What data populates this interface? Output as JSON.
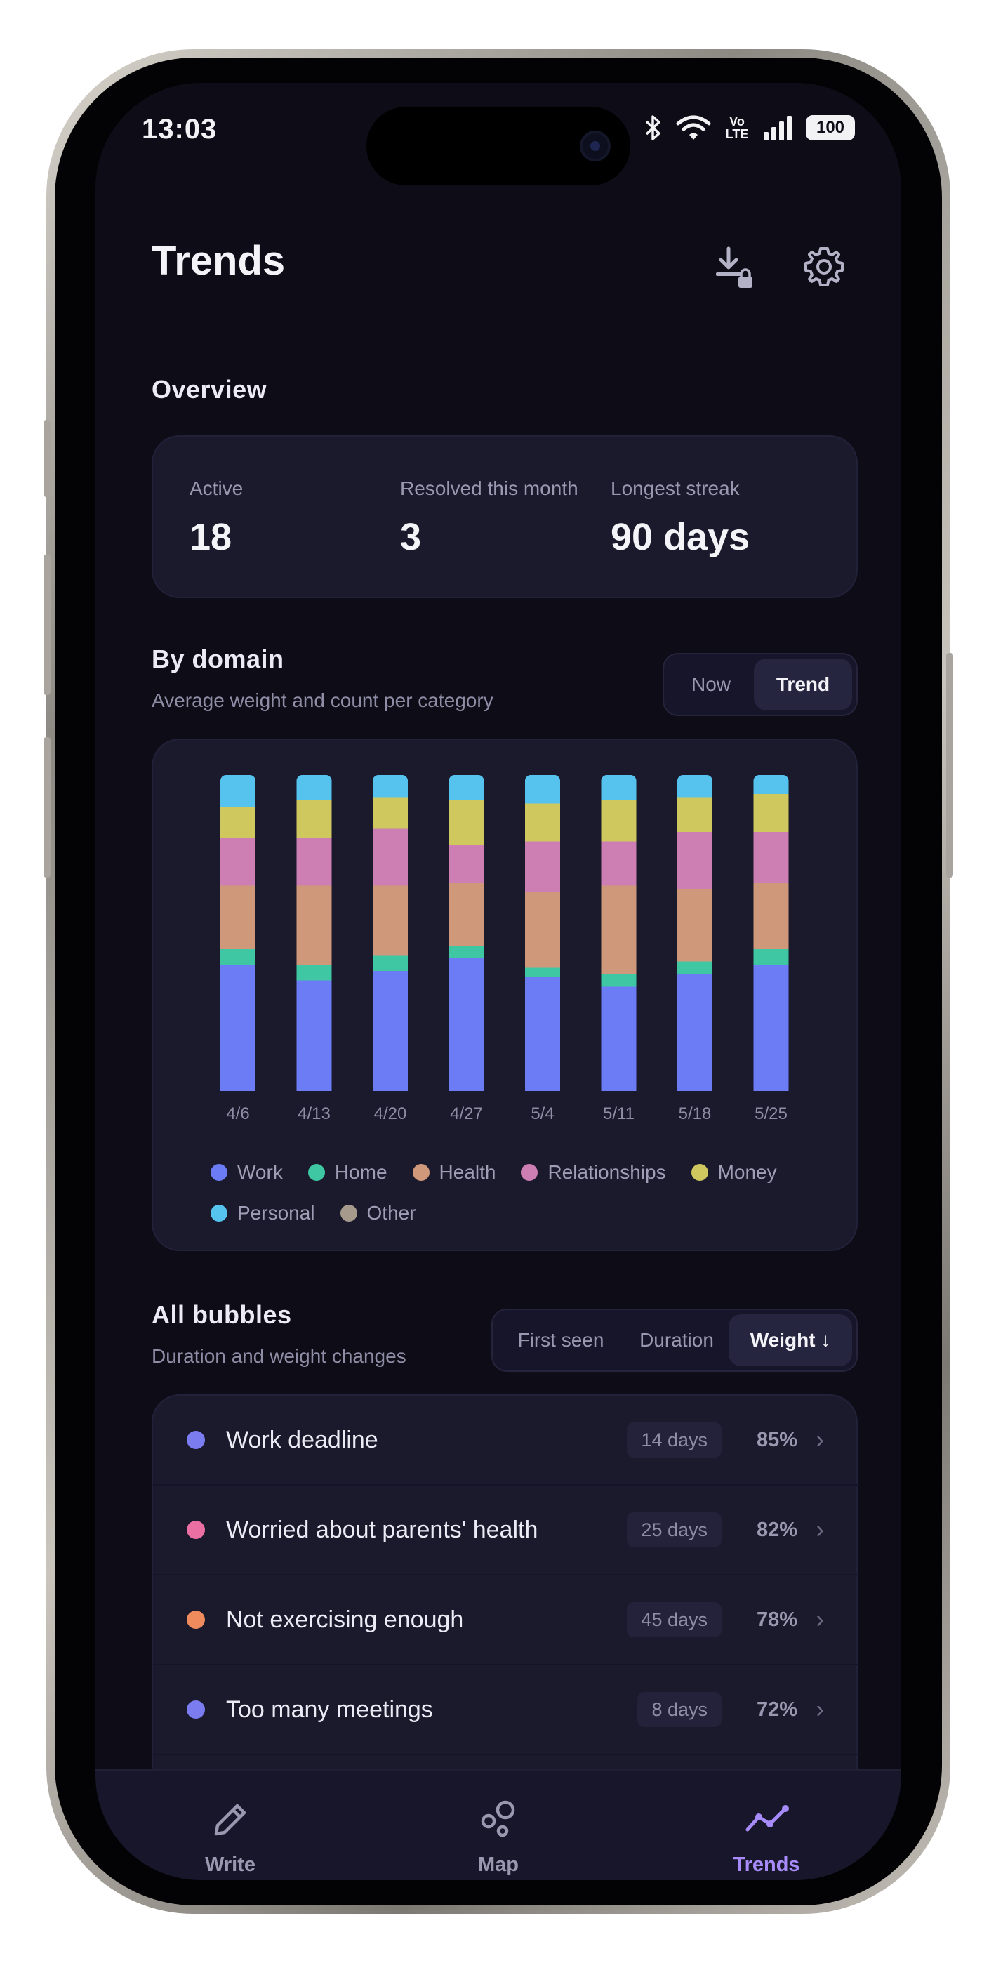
{
  "status_bar": {
    "time": "13:03",
    "network": "Vo LTE",
    "battery": "100"
  },
  "header": {
    "title": "Trends",
    "export_icon": "download-lock-icon",
    "settings_icon": "gear-icon"
  },
  "overview": {
    "heading": "Overview",
    "stats": [
      {
        "label": "Active",
        "value": "18"
      },
      {
        "label": "Resolved this month",
        "value": "3"
      },
      {
        "label": "Longest streak",
        "value": "90 days"
      }
    ]
  },
  "by_domain": {
    "heading": "By domain",
    "subtitle": "Average weight and count per category",
    "toggle": {
      "options": [
        "Now",
        "Trend"
      ],
      "selected": "Trend"
    }
  },
  "chart_data": {
    "type": "bar",
    "stacked": true,
    "categories": [
      "4/6",
      "4/13",
      "4/20",
      "4/27",
      "5/4",
      "5/11",
      "5/18",
      "5/25"
    ],
    "series": [
      {
        "name": "Work",
        "color": "#6b7cf5",
        "values": [
          40,
          35,
          38,
          42,
          36,
          33,
          37,
          40
        ]
      },
      {
        "name": "Home",
        "color": "#3fc7a3",
        "values": [
          5,
          5,
          5,
          4,
          3,
          4,
          4,
          5
        ]
      },
      {
        "name": "Health",
        "color": "#d0987a",
        "values": [
          20,
          25,
          22,
          20,
          24,
          28,
          23,
          21
        ]
      },
      {
        "name": "Relationships",
        "color": "#cd7fb4",
        "values": [
          15,
          15,
          18,
          12,
          16,
          14,
          18,
          16
        ]
      },
      {
        "name": "Money",
        "color": "#cfc85e",
        "values": [
          10,
          12,
          10,
          14,
          12,
          13,
          11,
          12
        ]
      },
      {
        "name": "Personal",
        "color": "#55c3ee",
        "values": [
          10,
          8,
          7,
          8,
          9,
          8,
          7,
          6
        ]
      },
      {
        "name": "Other",
        "color": "#a69a8c",
        "values": [
          0,
          0,
          0,
          0,
          0,
          0,
          0,
          0
        ]
      }
    ],
    "ylim": [
      0,
      100
    ],
    "legend_position": "bottom"
  },
  "bubbles": {
    "heading": "All bubbles",
    "subtitle": "Duration and weight changes",
    "sort": {
      "options": [
        "First seen",
        "Duration",
        "Weight ↓"
      ],
      "selected": "Weight ↓"
    },
    "items": [
      {
        "label": "Work deadline",
        "duration": "14 days",
        "weight": "85%",
        "color": "#7b7cf0"
      },
      {
        "label": "Worried about parents' health",
        "duration": "25 days",
        "weight": "82%",
        "color": "#ec6fa3"
      },
      {
        "label": "Not exercising enough",
        "duration": "45 days",
        "weight": "78%",
        "color": "#f08b5e"
      },
      {
        "label": "Too many meetings",
        "duration": "8 days",
        "weight": "72%",
        "color": "#7b7cf0"
      }
    ]
  },
  "nav": {
    "items": [
      {
        "label": "Write",
        "icon": "pencil-icon"
      },
      {
        "label": "Map",
        "icon": "bubbles-icon"
      },
      {
        "label": "Trends",
        "icon": "trend-line-icon"
      }
    ],
    "active": "Trends",
    "active_color": "#a78bfa"
  }
}
